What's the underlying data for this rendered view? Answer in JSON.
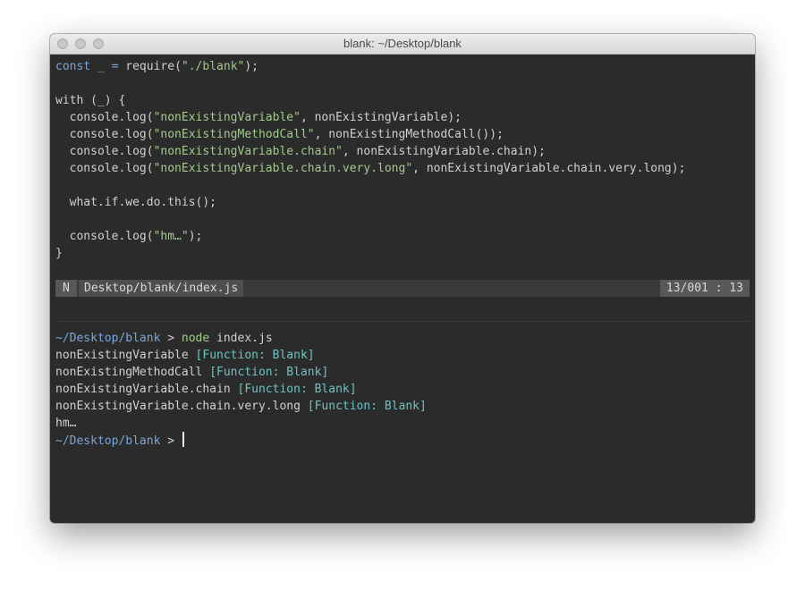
{
  "window": {
    "title": "blank: ~/Desktop/blank"
  },
  "editor": {
    "lines": [
      [
        {
          "t": "const",
          "c": "kw"
        },
        {
          "t": " "
        },
        {
          "t": "_",
          "c": "kw"
        },
        {
          "t": " "
        },
        {
          "t": "=",
          "c": "kw"
        },
        {
          "t": " require("
        },
        {
          "t": "\"./blank\"",
          "c": "str"
        },
        {
          "t": ");"
        }
      ],
      [],
      [
        {
          "t": "with (_) {"
        }
      ],
      [
        {
          "t": "  console.log("
        },
        {
          "t": "\"nonExistingVariable\"",
          "c": "str"
        },
        {
          "t": ", nonExistingVariable);"
        }
      ],
      [
        {
          "t": "  console.log("
        },
        {
          "t": "\"nonExistingMethodCall\"",
          "c": "str"
        },
        {
          "t": ", nonExistingMethodCall());"
        }
      ],
      [
        {
          "t": "  console.log("
        },
        {
          "t": "\"nonExistingVariable.chain\"",
          "c": "str"
        },
        {
          "t": ", nonExistingVariable.chain);"
        }
      ],
      [
        {
          "t": "  console.log("
        },
        {
          "t": "\"nonExistingVariable.chain.very.long\"",
          "c": "str"
        },
        {
          "t": ", nonExistingVariable.chain.very.long);"
        }
      ],
      [],
      [
        {
          "t": "  what.if.we.do.this();"
        }
      ],
      [],
      [
        {
          "t": "  console.log("
        },
        {
          "t": "\"hm…\"",
          "c": "str"
        },
        {
          "t": ");"
        }
      ],
      [
        {
          "t": "}"
        }
      ]
    ]
  },
  "statusline": {
    "mode": "N",
    "filename": "Desktop/blank/index.js",
    "position": "13/001 : 13"
  },
  "terminal": {
    "lines": [
      [
        {
          "t": "~/Desktop/blank",
          "c": "path"
        },
        {
          "t": " > "
        },
        {
          "t": "node",
          "c": "cmd"
        },
        {
          "t": " index.js"
        }
      ],
      [
        {
          "t": "nonExistingVariable "
        },
        {
          "t": "[Function: Blank]",
          "c": "fn"
        }
      ],
      [
        {
          "t": "nonExistingMethodCall "
        },
        {
          "t": "[Function: Blank]",
          "c": "fn"
        }
      ],
      [
        {
          "t": "nonExistingVariable.chain "
        },
        {
          "t": "[Function: Blank]",
          "c": "fn"
        }
      ],
      [
        {
          "t": "nonExistingVariable.chain.very.long "
        },
        {
          "t": "[Function: Blank]",
          "c": "fn"
        }
      ],
      [
        {
          "t": "hm…"
        }
      ]
    ],
    "prompt": {
      "path": "~/Desktop/blank",
      "symbol": " > "
    }
  }
}
